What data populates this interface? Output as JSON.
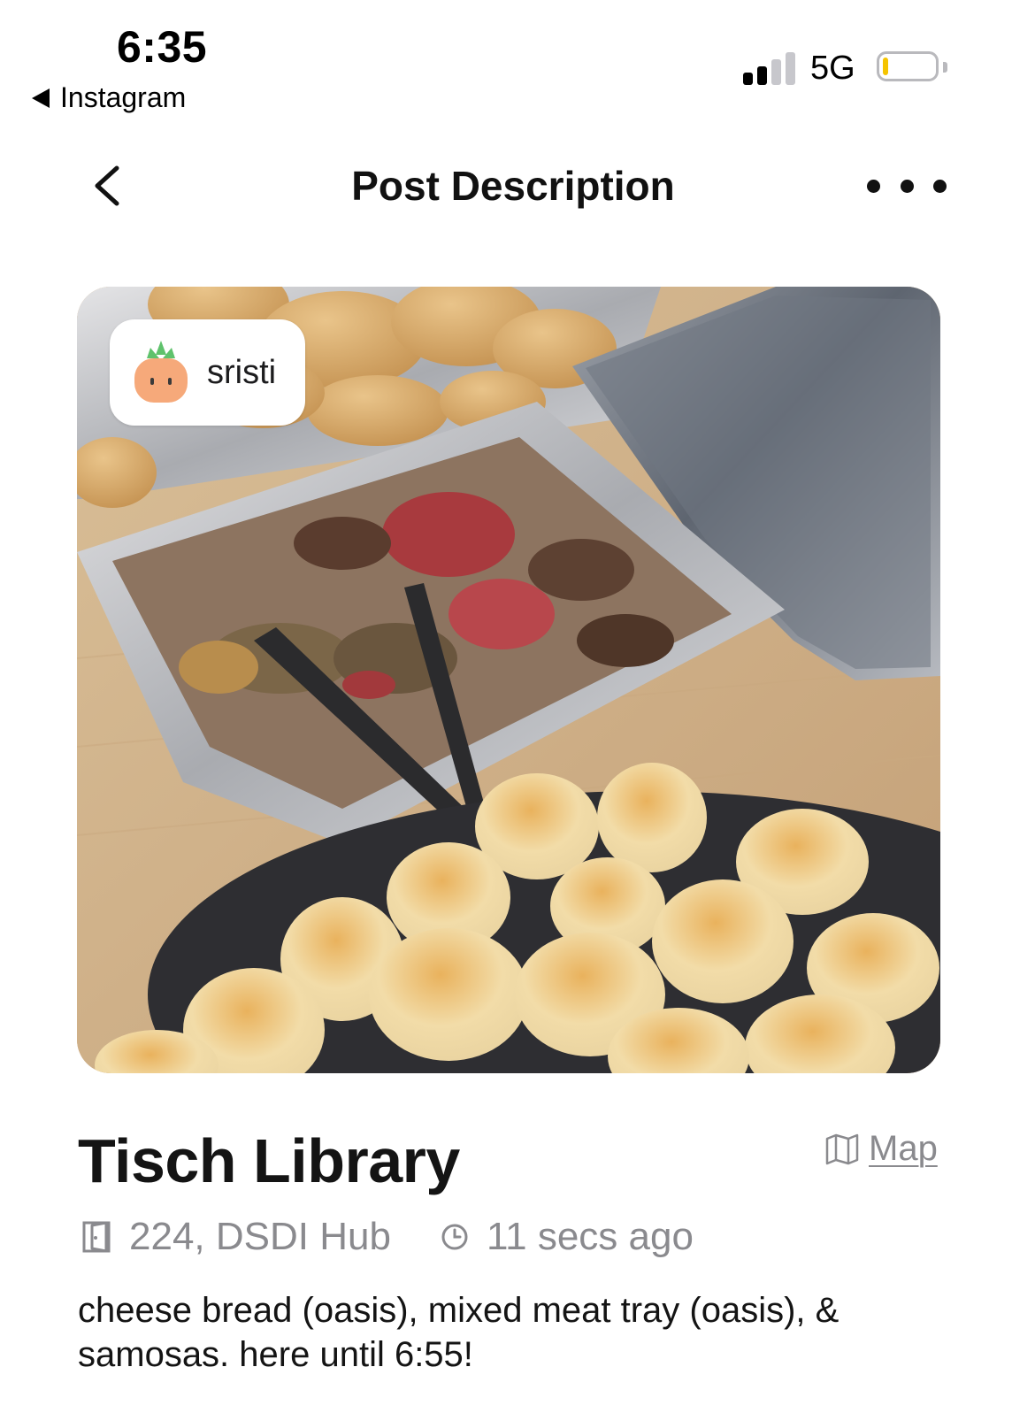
{
  "status_bar": {
    "time": "6:35",
    "back_app_label": "Instagram",
    "network": "5G",
    "signal_bars_filled": 2,
    "signal_bars_total": 4,
    "battery_level": 0.1,
    "battery_color": "#f5c400"
  },
  "nav": {
    "title": "Post Description",
    "back_icon": "chevron-left-icon",
    "more_icon": "more-horizontal-icon"
  },
  "post": {
    "author": "sristi",
    "avatar_icon": "onion-avatar-icon",
    "location_title": "Tisch Library",
    "map_label": "Map",
    "room": "224, DSDI Hub",
    "room_icon": "door-icon",
    "time_posted": "11 secs ago",
    "time_icon": "clock-icon",
    "description": "cheese bread (oasis), mixed meat tray (oasis), & samosas. here until 6:55!"
  },
  "colors": {
    "text_primary": "#141414",
    "text_secondary": "#8a8a8e",
    "avatar_body": "#f6a97a",
    "avatar_leaves": "#5fc26c"
  }
}
